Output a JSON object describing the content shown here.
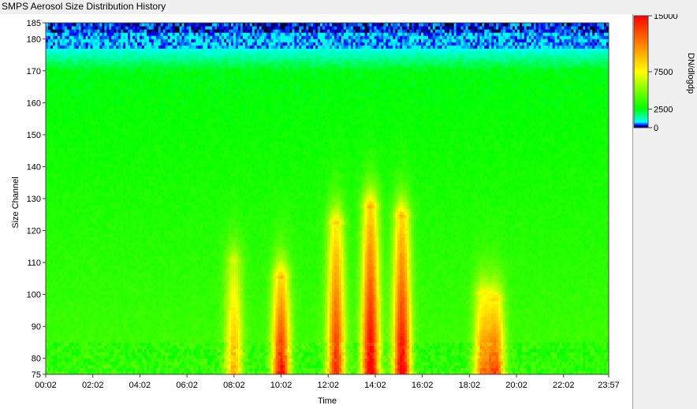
{
  "window": {
    "title": "SMPS Aerosol Size Distribution History"
  },
  "chart_data": {
    "type": "heatmap",
    "title": "",
    "xlabel": "Time",
    "ylabel": "Size Channel",
    "x_ticks": [
      "00:02",
      "02:02",
      "04:02",
      "06:02",
      "08:02",
      "10:02",
      "12:02",
      "14:02",
      "16:02",
      "18:02",
      "20:02",
      "22:02",
      "23:57"
    ],
    "x_range": [
      "00:02",
      "23:57"
    ],
    "y_ticks": [
      75,
      80,
      90,
      100,
      110,
      120,
      130,
      140,
      150,
      160,
      170,
      180,
      185
    ],
    "ylim": [
      75,
      185
    ],
    "colorbar": {
      "label": "DN/dlogdp",
      "ticks": [
        0,
        2500,
        7500,
        15000
      ],
      "range": [
        0,
        15000
      ],
      "colors": [
        "#000000",
        "#0000ff",
        "#00ffff",
        "#00ff00",
        "#ffff00",
        "#ff8000",
        "#ff0000"
      ]
    },
    "notes_visible": {
      "noise_band_channels": [
        177,
        185
      ],
      "baseline_level": 2500
    },
    "peaks": [
      {
        "time": "08:02",
        "channel_top": 110,
        "level": 9000
      },
      {
        "time": "10:02",
        "channel_top": 105,
        "level": 14000
      },
      {
        "time": "12:22",
        "channel_top": 122,
        "level": 13000
      },
      {
        "time": "13:50",
        "channel_top": 127,
        "level": 15000
      },
      {
        "time": "15:10",
        "channel_top": 124,
        "level": 14500
      },
      {
        "time": "18:35",
        "channel_top": 100,
        "level": 10000
      },
      {
        "time": "19:10",
        "channel_top": 98,
        "level": 11500
      }
    ]
  }
}
